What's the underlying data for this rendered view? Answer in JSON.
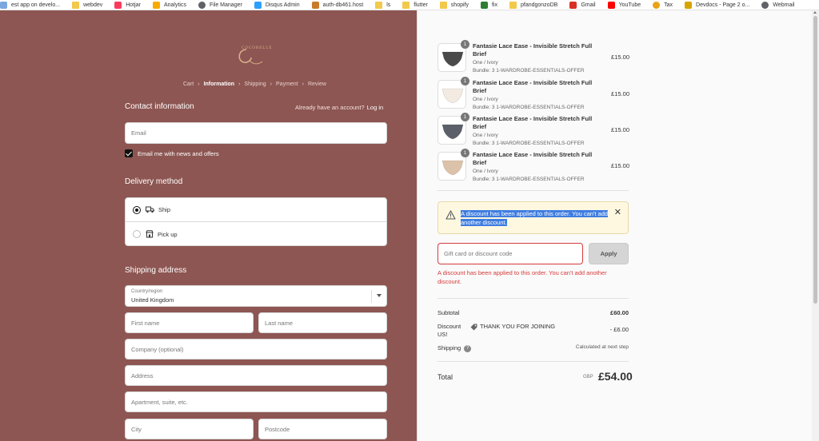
{
  "bookmarks": [
    {
      "label": "est app on develo...",
      "icon": "app-icon",
      "color": "#7aa7e0"
    },
    {
      "label": "webdev",
      "icon": "folder-icon",
      "color": "#f2c94c"
    },
    {
      "label": "Hotjar",
      "icon": "hotjar-icon",
      "color": "#fd3a5c"
    },
    {
      "label": "Analytics",
      "icon": "analytics-icon",
      "color": "#f9ab00"
    },
    {
      "label": "File Manager",
      "icon": "globe-icon",
      "color": "#5f6368"
    },
    {
      "label": "Disqus Admin",
      "icon": "disqus-icon",
      "color": "#2e9fff"
    },
    {
      "label": "auth-db461.host",
      "icon": "host-icon",
      "color": "#c97b2a"
    },
    {
      "label": "ls",
      "icon": "folder-icon",
      "color": "#f2c94c"
    },
    {
      "label": "flutter",
      "icon": "folder-icon",
      "color": "#f2c94c"
    },
    {
      "label": "shopify",
      "icon": "folder-icon",
      "color": "#f2c94c"
    },
    {
      "label": "fix",
      "icon": "fix-icon",
      "color": "#2e7d32"
    },
    {
      "label": "pfandgonzoDB",
      "icon": "folder-icon",
      "color": "#f2c94c"
    },
    {
      "label": "Gmail",
      "icon": "gmail-icon",
      "color": "#d93025"
    },
    {
      "label": "YouTube",
      "icon": "youtube-icon",
      "color": "#ff0000"
    },
    {
      "label": "Tax",
      "icon": "tax-icon",
      "color": "#e8a317"
    },
    {
      "label": "Devdocs - Page 2 o...",
      "icon": "devdocs-icon",
      "color": "#d6a400"
    },
    {
      "label": "Webmail",
      "icon": "globe-icon",
      "color": "#5f6368"
    }
  ],
  "brand": {
    "logo_text": "COCOBELLE",
    "logo_color": "#d7b08a"
  },
  "breadcrumb": [
    "Cart",
    "Information",
    "Shipping",
    "Payment",
    "Review"
  ],
  "contact": {
    "title": "Contact information",
    "account_question": "Already have an account?",
    "login_link": "Log in",
    "email_placeholder": "Email",
    "newsletter_label": "Email me with news and offers"
  },
  "delivery": {
    "title": "Delivery method",
    "options": [
      {
        "label": "Ship",
        "selected": true
      },
      {
        "label": "Pick up",
        "selected": false
      }
    ]
  },
  "shipping": {
    "title": "Shipping address",
    "country_label": "Country/region",
    "country_value": "United Kingdom",
    "first_name_placeholder": "First name",
    "last_name_placeholder": "Last name",
    "company_placeholder": "Company (optional)",
    "address_placeholder": "Address",
    "apartment_placeholder": "Apartment, suite, etc.",
    "city_placeholder": "City",
    "postcode_placeholder": "Postcode"
  },
  "products": [
    {
      "qty": "1",
      "name": "Fantasie Lace Ease - Invisible Stretch Full Brief",
      "variant": "One / Ivory",
      "bundle": "Bundle: 3 1-WARDROBE-ESSENTIALS-OFFER",
      "price": "£15.00",
      "swatch": "#4a4a4a"
    },
    {
      "qty": "1",
      "name": "Fantasie Lace Ease - Invisible Stretch Full Brief",
      "variant": "One / Ivory",
      "bundle": "Bundle: 3 1-WARDROBE-ESSENTIALS-OFFER",
      "price": "£15.00",
      "swatch": "#f3ebe2"
    },
    {
      "qty": "1",
      "name": "Fantasie Lace Ease - Invisible Stretch Full Brief",
      "variant": "One / Ivory",
      "bundle": "Bundle: 3 1-WARDROBE-ESSENTIALS-OFFER",
      "price": "£15.00",
      "swatch": "#5b5f69"
    },
    {
      "qty": "1",
      "name": "Fantasie Lace Ease - Invisible Stretch Full Brief",
      "variant": "One / Ivory",
      "bundle": "Bundle: 3 1-WARDROBE-ESSENTIALS-OFFER",
      "price": "£15.00",
      "swatch": "#dcc2a9"
    }
  ],
  "notice": {
    "message": "A discount has been applied to this order. You can't add another discount."
  },
  "discount": {
    "placeholder": "Gift card or discount code",
    "apply_label": "Apply",
    "error": "A discount has been applied to this order. You can't add another discount."
  },
  "summary": {
    "subtotal_label": "Subtotal",
    "subtotal_value": "£60.00",
    "discount_label": "Discount",
    "discount_code": "THANK YOU FOR JOINING",
    "discount_code_line2": "US!",
    "discount_value": "- £6.00",
    "shipping_label": "Shipping",
    "shipping_value": "Calculated at next step",
    "total_label": "Total",
    "currency": "GBP",
    "total_value": "£54.00"
  },
  "colors": {
    "left_panel": "#8d5652",
    "right_panel": "#fafafa",
    "error": "#d63b3b",
    "notice_bg": "#fff8e1",
    "selection": "#3f7de0"
  }
}
